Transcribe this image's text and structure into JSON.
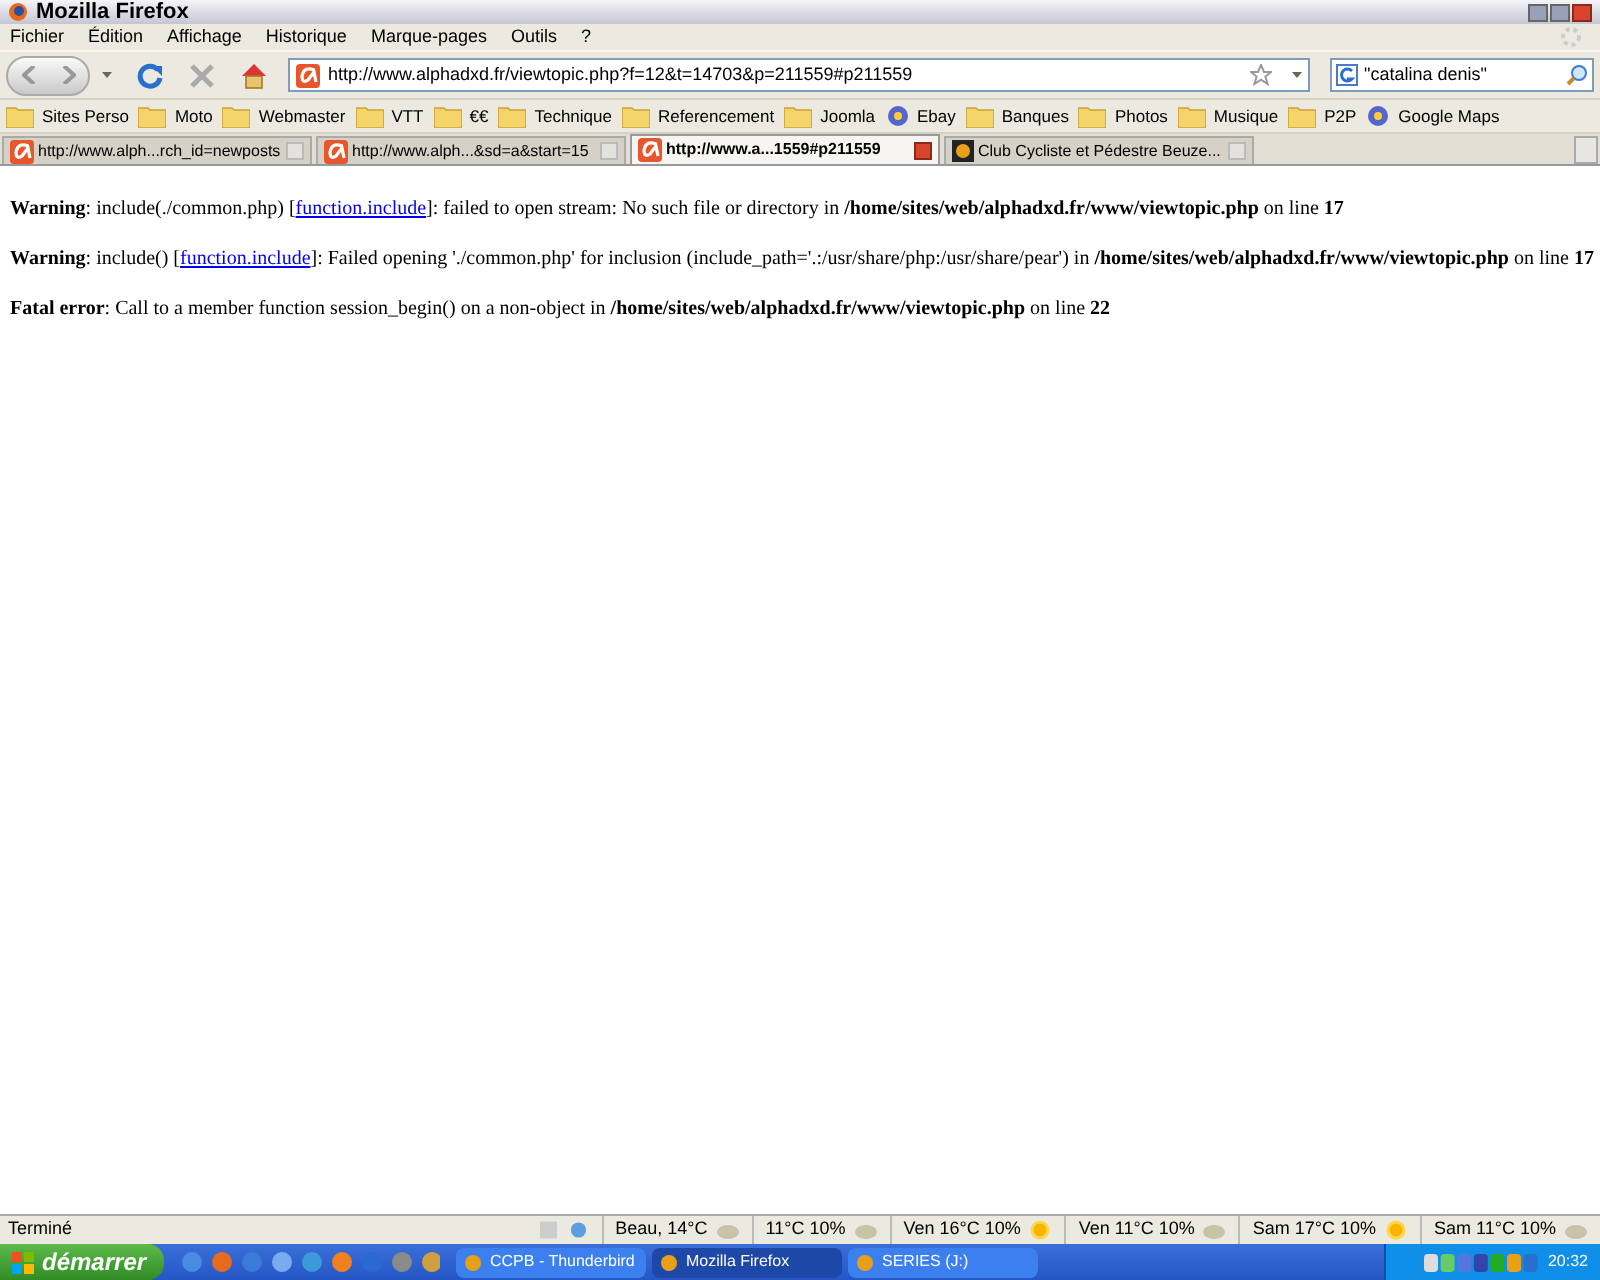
{
  "window": {
    "title": "Mozilla Firefox"
  },
  "menu": [
    "Fichier",
    "Édition",
    "Affichage",
    "Historique",
    "Marque-pages",
    "Outils",
    "?"
  ],
  "navigation": {
    "url": "http://www.alphadxd.fr/viewtopic.php?f=12&t=14703&p=211559#p211559",
    "search": "\"catalina denis\""
  },
  "bookmarks": [
    {
      "label": "Sites Perso",
      "kind": "folder"
    },
    {
      "label": "Moto",
      "kind": "folder"
    },
    {
      "label": "Webmaster",
      "kind": "folder"
    },
    {
      "label": "VTT",
      "kind": "folder"
    },
    {
      "label": "€€",
      "kind": "folder"
    },
    {
      "label": "Technique",
      "kind": "folder"
    },
    {
      "label": "Referencement",
      "kind": "folder"
    },
    {
      "label": "Joomla",
      "kind": "folder"
    },
    {
      "label": "Ebay",
      "kind": "site"
    },
    {
      "label": "Banques",
      "kind": "folder"
    },
    {
      "label": "Photos",
      "kind": "folder"
    },
    {
      "label": "Musique",
      "kind": "folder"
    },
    {
      "label": "P2P",
      "kind": "folder"
    },
    {
      "label": "Google Maps",
      "kind": "site"
    }
  ],
  "tabs": [
    {
      "label": "http://www.alph...rch_id=newposts",
      "selected": false
    },
    {
      "label": "http://www.alph...&sd=a&start=15",
      "selected": false
    },
    {
      "label": "http://www.a...1559#p211559",
      "selected": true
    },
    {
      "label": "Club Cycliste et Pédestre Beuze...",
      "selected": false
    }
  ],
  "messages": [
    {
      "before": "**Warning**: include(./common.php) [",
      "link": "function.include",
      "after": "]: failed to open stream: No such file or directory in **/home/sites/web/alphadxd.fr/www/viewtopic.php** on line **17**"
    },
    {
      "before": "**Warning**: include() [",
      "link": "function.include",
      "after": "]: Failed opening './common.php' for inclusion (include_path='.:/usr/share/php:/usr/share/pear') in **/home/sites/web/alphadxd.fr/www/viewtopic.php** on line **17**"
    },
    {
      "before": "**Fatal error**: Call to a member function session_begin() on a non-object in **/home/sites/web/alphadxd.fr/www/viewtopic.php** on line **22**"
    }
  ],
  "status_bar": {
    "text": "Terminé",
    "weather": [
      {
        "text": "Beau, 14°C",
        "kind": "cloud"
      },
      {
        "text": "11°C 10%",
        "kind": "cloud"
      },
      {
        "text": "Ven 16°C 10%",
        "kind": "sun"
      },
      {
        "text": "Ven 11°C 10%",
        "kind": "cloud"
      },
      {
        "text": "Sam 17°C 10%",
        "kind": "sun"
      },
      {
        "text": "Sam 11°C 10%",
        "kind": "cloud"
      }
    ]
  },
  "taskbar": {
    "start": "démarrer",
    "tasks": [
      {
        "label": "CCPB - Thunderbird",
        "selected": false
      },
      {
        "label": "Mozilla Firefox",
        "selected": true
      },
      {
        "label": "SERIES (J:)",
        "selected": false
      }
    ],
    "clock": "20:32"
  }
}
